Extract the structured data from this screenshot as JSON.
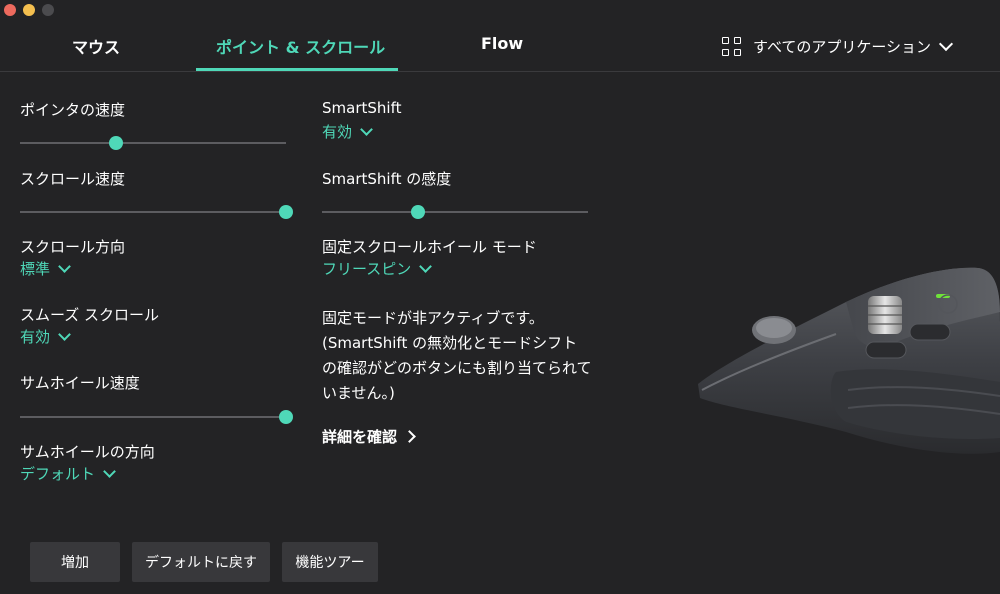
{
  "nav": {
    "tabs": [
      {
        "label": "マウス"
      },
      {
        "label": "ポイント & スクロール"
      },
      {
        "label": "Flow"
      }
    ],
    "app_selector": {
      "label": "すべてのアプリケーション"
    }
  },
  "settings": {
    "pointer_speed": {
      "label": "ポインタの速度",
      "level": 0.36
    },
    "scroll_speed": {
      "label": "スクロール速度",
      "level": 1.0
    },
    "scroll_direction": {
      "label": "スクロール方向",
      "value": "標準"
    },
    "smooth_scroll": {
      "label": "スムーズ スクロール",
      "value": "有効"
    },
    "thumbwheel_speed": {
      "label": "サムホイール速度",
      "level": 1.0
    },
    "thumbwheel_direction": {
      "label": "サムホイールの方向",
      "value": "デフォルト"
    },
    "smartshift": {
      "label": "SmartShift",
      "value": "有効"
    },
    "smartshift_sensitivity": {
      "label": "SmartShift の感度",
      "level": 0.36
    },
    "ratchet_mode": {
      "label": "固定スクロールホイール モード",
      "value": "フリースピン"
    }
  },
  "info": {
    "text": "固定モードが非アクティブです。(SmartShift の無効化とモードシフトの確認がどのボタンにも割り当てられていません。)",
    "link": "詳細を確認"
  },
  "buttons": {
    "add": "増加",
    "reset": "デフォルトに戻す",
    "tour": "機能ツアー"
  },
  "colors": {
    "accent": "#4fd8b8",
    "background": "#232325",
    "button_bg": "#38383b"
  }
}
